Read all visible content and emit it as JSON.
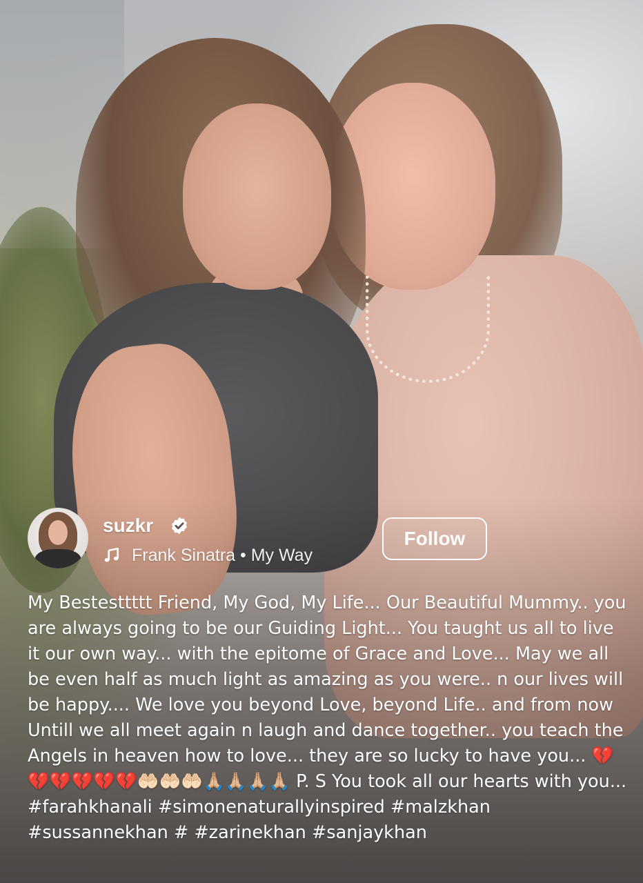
{
  "post": {
    "username": "suzkr",
    "verified": true,
    "audio": {
      "artist": "Frank Sinatra",
      "separator": "•",
      "track": "My Way"
    },
    "follow_label": "Follow",
    "caption": "My Bestesttttt Friend, My God, My Life... Our Beautiful Mummy.. you are always going to be our Guiding Light... You taught us all to live it our own way... with the epitome of Grace and Love... May we all be even half as much light as amazing as you were.. n our lives will be happy.... We love you beyond Love, beyond Life.. and from now Untill we all meet again n laugh and dance together.. you teach the Angels in heaven how to love... they are so lucky to have you... 💔💔💔💔💔💔🤲🏻🤲🏻🤲🏻🙏🏼🙏🏼🙏🏼🙏🏼 P. S You took all our hearts with you... #farahkhanali #simonenaturallyinspired #malzkhan #sussannekhan # #zarinekhan #sanjaykhan"
  },
  "icons": {
    "verified": "verified-badge-icon",
    "music": "music-note-icon"
  },
  "colors": {
    "text": "#ffffff",
    "button_border": "#ffffff"
  }
}
